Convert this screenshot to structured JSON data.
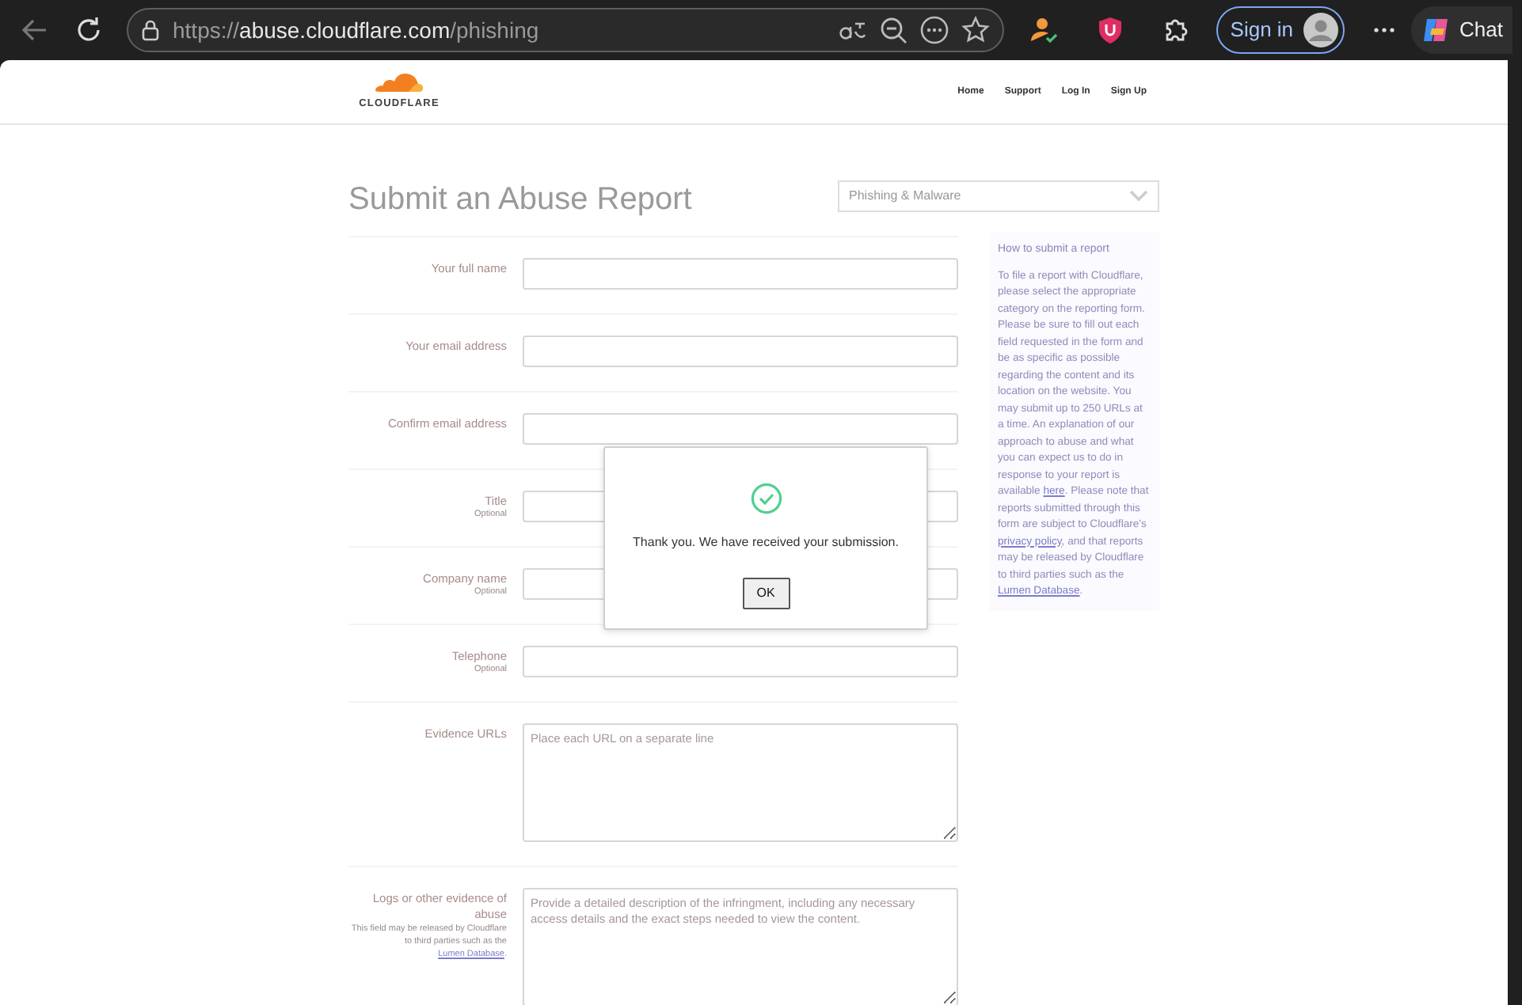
{
  "browser": {
    "url_scheme": "https://",
    "url_host": "abuse.cloudflare.com",
    "url_path": "/phishing",
    "sign_in": "Sign in",
    "chat": "Chat"
  },
  "site_header": {
    "logo_text": "CLOUDFLARE",
    "nav": [
      "Home",
      "Support",
      "Log In",
      "Sign Up"
    ]
  },
  "form": {
    "title": "Submit an Abuse Report",
    "category": "Phishing & Malware",
    "fields": [
      {
        "kind": "input",
        "label": "Your full name"
      },
      {
        "kind": "input",
        "label": "Your email address"
      },
      {
        "kind": "input",
        "label": "Confirm email address"
      },
      {
        "kind": "input",
        "label": "Title",
        "note": "Optional"
      },
      {
        "kind": "input",
        "label": "Company name",
        "note": "Optional"
      },
      {
        "kind": "input",
        "label": "Telephone",
        "note": "Optional"
      },
      {
        "kind": "textarea",
        "label": "Evidence URLs",
        "placeholder": "Place each URL on a separate line"
      },
      {
        "kind": "textarea",
        "label": "Logs or other evidence of abuse",
        "note_parts": [
          {
            "text": "This field may be released by Cloudflare to third parties such as the ",
            "link": false
          },
          {
            "text": "Lumen Database",
            "link": true
          },
          {
            "text": ".",
            "link": false
          }
        ],
        "placeholder": "Provide a detailed description of the infringment, including any necessary access details and the exact steps needed to view the content."
      }
    ]
  },
  "help": {
    "heading": "How to submit a report",
    "parts": [
      {
        "text": "To file a report with Cloudflare, please select the appropriate category on the reporting form. Please be sure to fill out each field requested in the form and be as specific as possible regarding the content and its location on the website. You may submit up to 250 URLs at a time. An explanation of our approach to abuse and what you can expect us to do in response to your report is available ",
        "link": false
      },
      {
        "text": "here",
        "link": true
      },
      {
        "text": ". Please note that reports submitted through this form are subject to Cloudflare's ",
        "link": false
      },
      {
        "text": "privacy policy",
        "link": true
      },
      {
        "text": ", and that reports may be released by Cloudflare to third parties such as the ",
        "link": false
      },
      {
        "text": "Lumen Database",
        "link": true
      },
      {
        "text": ".",
        "link": false
      }
    ]
  },
  "dialog": {
    "message": "Thank you. We have received your submission.",
    "button": "OK"
  }
}
